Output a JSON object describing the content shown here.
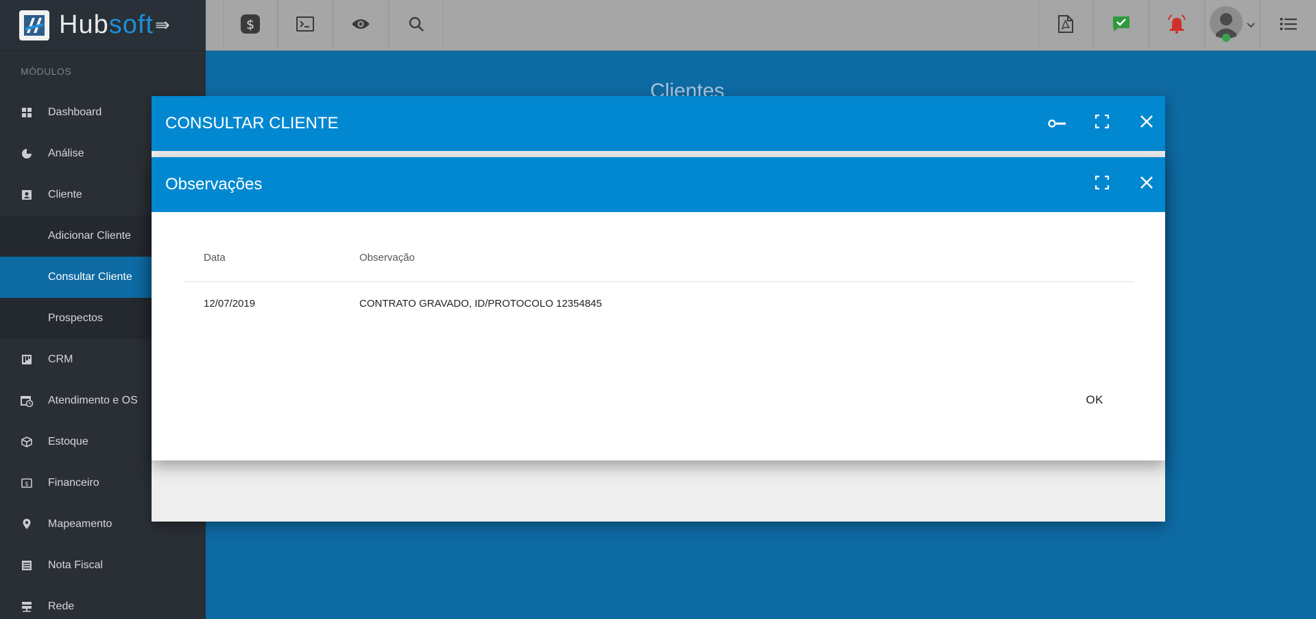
{
  "brand": {
    "name_part1": "Hub",
    "name_part2": "soft"
  },
  "sidebar": {
    "section_label": "MÓDULOS",
    "items": [
      {
        "label": "Dashboard",
        "icon": "dashboard-icon"
      },
      {
        "label": "Análise",
        "icon": "pie-chart-icon"
      },
      {
        "label": "Cliente",
        "icon": "contact-card-icon"
      },
      {
        "label": "Adicionar Cliente",
        "sub": true
      },
      {
        "label": "Consultar Cliente",
        "sub": true,
        "active": true
      },
      {
        "label": "Prospectos",
        "sub": true
      },
      {
        "label": "CRM",
        "icon": "kanban-icon"
      },
      {
        "label": "Atendimento e OS",
        "icon": "calendar-clock-icon"
      },
      {
        "label": "Estoque",
        "icon": "box-icon"
      },
      {
        "label": "Financeiro",
        "icon": "money-icon"
      },
      {
        "label": "Mapeamento",
        "icon": "map-pin-icon"
      },
      {
        "label": "Nota Fiscal",
        "icon": "document-icon"
      },
      {
        "label": "Rede",
        "icon": "server-icon"
      }
    ]
  },
  "topbar": {
    "left_icons": [
      "dollar-icon",
      "terminal-icon",
      "eye-icon",
      "search-icon"
    ],
    "right_icons": [
      "pdf-icon",
      "chat-check-icon",
      "alarm-icon",
      "avatar",
      "list-menu-icon"
    ]
  },
  "page": {
    "title": "Clientes"
  },
  "modal_back": {
    "title": "CONSULTAR CLIENTE"
  },
  "modal_front": {
    "title": "Observações",
    "columns": {
      "date": "Data",
      "obs": "Observação"
    },
    "rows": [
      {
        "date": "12/07/2019",
        "obs": "CONTRATO GRAVADO, ID/PROTOCOLO 12354845"
      }
    ],
    "ok_label": "OK"
  },
  "colors": {
    "primary": "#0288d1",
    "background": "#0e6aa3",
    "sidebar": "#2a2f36",
    "topbar": "#a6a6a6"
  }
}
